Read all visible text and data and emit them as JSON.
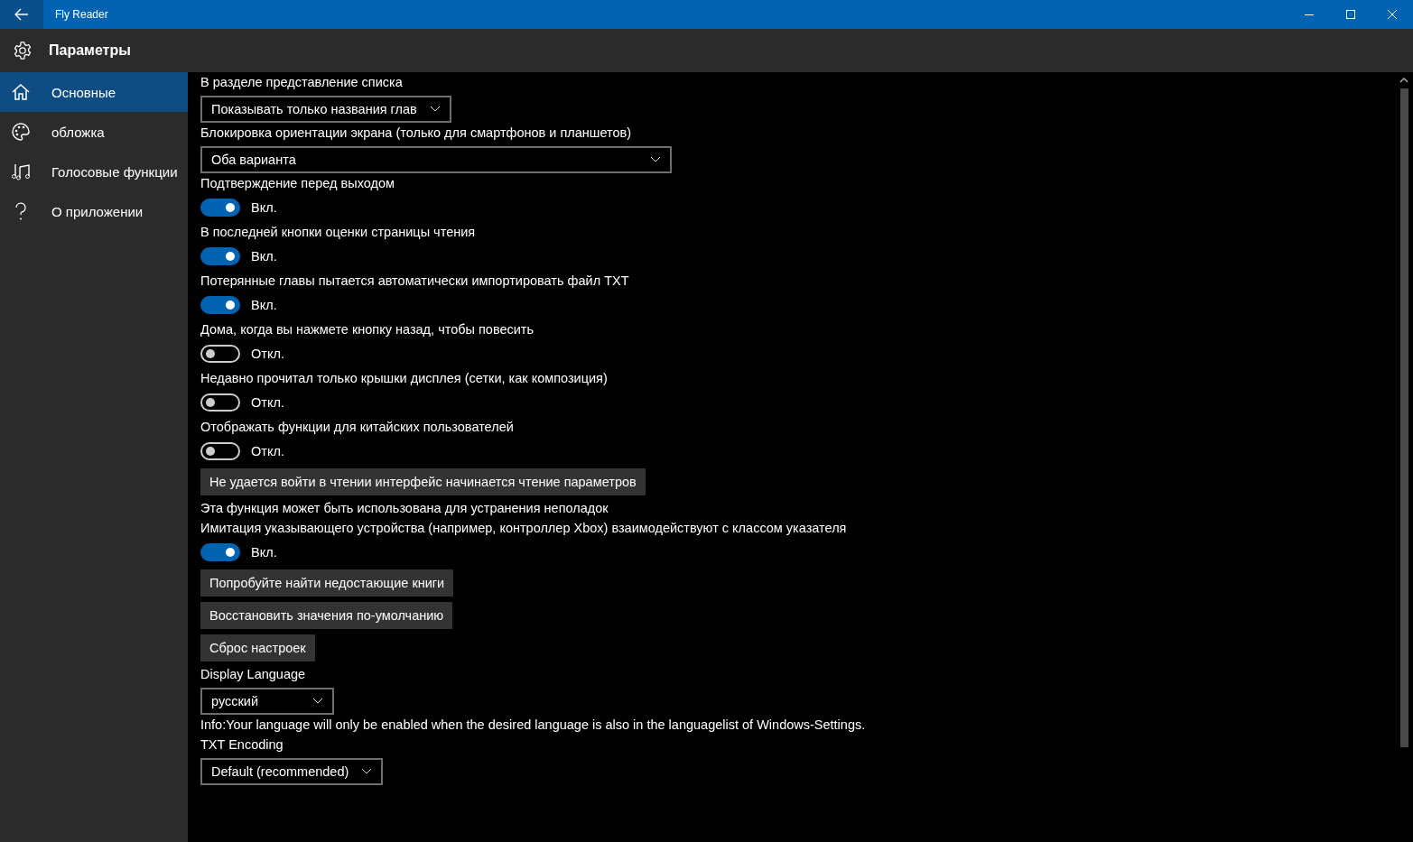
{
  "window": {
    "title": "Fly Reader"
  },
  "header": {
    "title": "Параметры"
  },
  "sidebar": {
    "items": [
      {
        "label": "Основные",
        "selected": true
      },
      {
        "label": "обложка",
        "selected": false
      },
      {
        "label": "Голосовые функции",
        "selected": false
      },
      {
        "label": "О приложении",
        "selected": false
      }
    ]
  },
  "settings": [
    {
      "kind": "label",
      "text": "В разделе представление списка"
    },
    {
      "kind": "dropdown",
      "value": "Показывать только названия глав"
    },
    {
      "kind": "label",
      "text": "Блокировка ориентации экрана (только для смартфонов и планшетов)"
    },
    {
      "kind": "widedropdown",
      "value": "Оба варианта"
    },
    {
      "kind": "label",
      "text": "Подтверждение перед выходом"
    },
    {
      "kind": "toggle",
      "on": true,
      "state": "Вкл."
    },
    {
      "kind": "label",
      "text": "В последней кнопки оценки страницы чтения"
    },
    {
      "kind": "toggle",
      "on": true,
      "state": "Вкл."
    },
    {
      "kind": "label",
      "text": "Потерянные главы пытается автоматически импортировать файл TXT"
    },
    {
      "kind": "toggle",
      "on": true,
      "state": "Вкл."
    },
    {
      "kind": "label",
      "text": "Дома, когда вы нажмете кнопку назад, чтобы повесить"
    },
    {
      "kind": "toggle",
      "on": false,
      "state": "Откл."
    },
    {
      "kind": "label",
      "text": "Недавно прочитал только крышки дисплея (сетки, как композиция)"
    },
    {
      "kind": "toggle",
      "on": false,
      "state": "Откл."
    },
    {
      "kind": "label",
      "text": "Отображать функции для китайских пользователей"
    },
    {
      "kind": "toggle",
      "on": false,
      "state": "Откл."
    },
    {
      "kind": "button",
      "text": "Не удается войти в чтении интерфейс начинается чтение параметров"
    },
    {
      "kind": "label",
      "text": "Эта функция может быть использована для устранения неполадок"
    },
    {
      "kind": "label",
      "text": "Имитация указывающего устройства (например, контроллер Xbox) взаимодействуют с классом указателя"
    },
    {
      "kind": "toggle",
      "on": true,
      "state": "Вкл."
    },
    {
      "kind": "button",
      "text": "Попробуйте найти недостающие книги"
    },
    {
      "kind": "button",
      "text": "Восстановить значения по-умолчанию"
    },
    {
      "kind": "button",
      "text": "Сброс настроек"
    },
    {
      "kind": "label",
      "text": "Display Language"
    },
    {
      "kind": "dropdown",
      "value": "русский"
    },
    {
      "kind": "label",
      "text": "Info:Your language will only be enabled when the desired language is also in the languagelist of Windows-Settings."
    },
    {
      "kind": "label",
      "text": "TXT Encoding"
    },
    {
      "kind": "dropdown",
      "value": "Default (recommended)"
    }
  ]
}
